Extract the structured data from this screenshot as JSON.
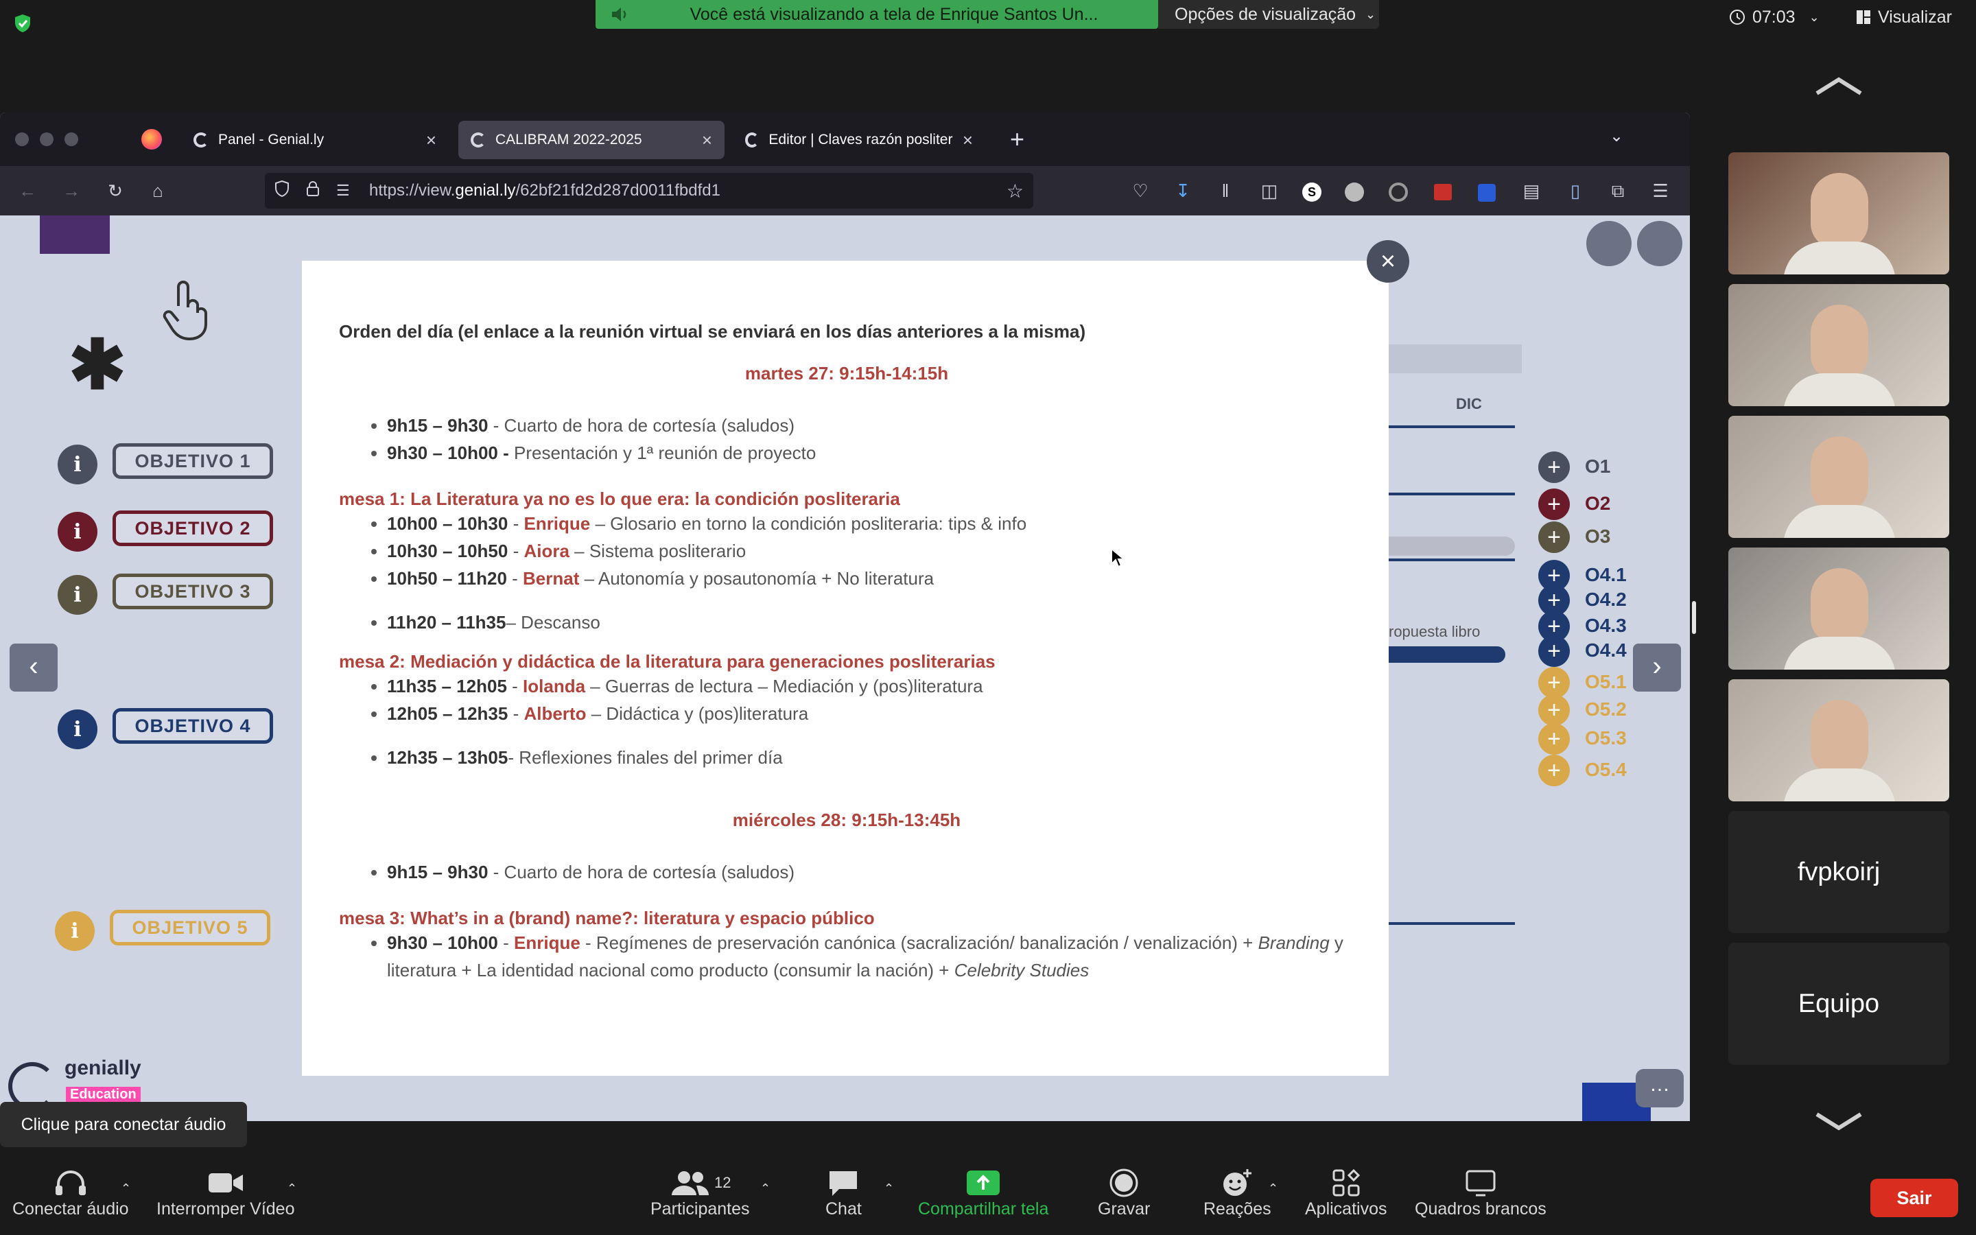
{
  "zoom": {
    "share_banner": "Você está visualizando a tela de Enrique Santos Un...",
    "view_options": "Opções de visualização",
    "time": "07:03",
    "view_button": "Visualizar",
    "participants": [
      {
        "name": "",
        "kind": "video"
      },
      {
        "name": "",
        "kind": "video"
      },
      {
        "name": "",
        "kind": "video"
      },
      {
        "name": "",
        "kind": "video"
      },
      {
        "name": "",
        "kind": "video"
      },
      {
        "name": "fvpkoirj",
        "kind": "name"
      },
      {
        "name": "Equipo",
        "kind": "name"
      }
    ],
    "tooltip": "Clique para conectar áudio",
    "toolbar": {
      "audio": "Conectar áudio",
      "video": "Interromper Vídeo",
      "participants": "Participantes",
      "participants_count": "12",
      "chat": "Chat",
      "share": "Compartilhar tela",
      "record": "Gravar",
      "reactions": "Reações",
      "apps": "Aplicativos",
      "whiteboards": "Quadros brancos",
      "leave": "Sair"
    },
    "colors": {
      "banner": "#3aa452",
      "leave": "#d92d20",
      "share_icon": "#2ebd4f"
    }
  },
  "browser": {
    "tabs": [
      {
        "title": "Panel - Genial.ly",
        "active": false
      },
      {
        "title": "CALIBRAM 2022-2025",
        "active": true
      },
      {
        "title": "Editor | Claves razón posliteraria",
        "active": false
      }
    ],
    "url_prefix": "https://view.",
    "url_domain": "genial.ly",
    "url_path": "/62bf21fd2d287d0011fbdfd1"
  },
  "slide": {
    "objectives": [
      {
        "label": "OBJETIVO 1",
        "color": "#4a4f60"
      },
      {
        "label": "OBJETIVO 2",
        "color": "#6b1a2a"
      },
      {
        "label": "OBJETIVO 3",
        "color": "#5a5540"
      },
      {
        "label": "OBJETIVO 4",
        "color": "#1e3a6e"
      },
      {
        "label": "OBJETIVO 5",
        "color": "#d9a84a"
      }
    ],
    "right_items": [
      {
        "label": "O1",
        "color": "#4a4f60"
      },
      {
        "label": "O2",
        "color": "#6b1a2a"
      },
      {
        "label": "O3",
        "color": "#5a5540"
      },
      {
        "label": "O4.1",
        "color": "#1e3a6e"
      },
      {
        "label": "O4.2",
        "color": "#1e3a6e"
      },
      {
        "label": "O4.3",
        "color": "#1e3a6e"
      },
      {
        "label": "O4.4",
        "color": "#1e3a6e"
      },
      {
        "label": "O5.1",
        "color": "#d9a84a"
      },
      {
        "label": "O5.2",
        "color": "#d9a84a"
      },
      {
        "label": "O5.3",
        "color": "#d9a84a"
      },
      {
        "label": "O5.4",
        "color": "#d9a84a"
      }
    ],
    "month": "DIC",
    "bar_text": "ropuesta libro",
    "brand": "genially",
    "brand_sub": "Education"
  },
  "modal": {
    "heading": "Orden del día (el enlace a la reunión virtual se enviará en los días anteriores a la misma)",
    "day1": "martes 27: 9:15h-14:15h",
    "intro1": [
      {
        "time": "9h15 – 9h30",
        "text": " - Cuarto de hora de cortesía (saludos)"
      },
      {
        "time": "9h30 – 10h00 -",
        "text": " Presentación y 1ª reunión de proyecto"
      }
    ],
    "mesa1": "mesa 1: La Literatura ya no es lo que era: la condición posliteraria",
    "mesa1_items": [
      {
        "time": "10h00 – 10h30",
        "sep": " - ",
        "name": "Enrique",
        "text": " – Glosario en torno la condición posliteraria: tips & info"
      },
      {
        "time": "10h30 – 10h50",
        "sep": " - ",
        "name": "Aiora",
        "text": " – Sistema posliterario"
      },
      {
        "time": "10h50 – 11h20",
        "sep": " - ",
        "name": "Bernat",
        "text": " – Autonomía y posautonomía + No literatura"
      }
    ],
    "break1": {
      "time": "11h20 – 11h35",
      "text": "– Descanso"
    },
    "mesa2": "mesa 2: Mediación y didáctica de la literatura para generaciones posliterarias",
    "mesa2_items": [
      {
        "time": "11h35 – 12h05",
        "sep": " - ",
        "name": "Iolanda",
        "text": " – Guerras de lectura – Mediación y (pos)literatura"
      },
      {
        "time": "12h05 – 12h35",
        "sep": " - ",
        "name": "Alberto",
        "text": " – Didáctica y (pos)literatura"
      }
    ],
    "final1": {
      "time": "12h35 – 13h05",
      "text": "- Reflexiones finales del primer día"
    },
    "day2": "miércoles 28: 9:15h-13:45h",
    "intro2": {
      "time": "9h15 – 9h30",
      "text": " - Cuarto de hora de cortesía (saludos)"
    },
    "mesa3": "mesa 3: What’s in a (brand) name?: literatura y espacio público",
    "mesa3_item": {
      "time": "9h30 – 10h00",
      "sep": " - ",
      "name": "Enrique",
      "text": " - Regímenes de preservación canónica (sacralización/ banalización / venalización) + ",
      "italic1": "Branding",
      "text2": " y literatura + La identidad nacional como producto (consumir la nación) + ",
      "italic2": "Celebrity Studies"
    }
  }
}
